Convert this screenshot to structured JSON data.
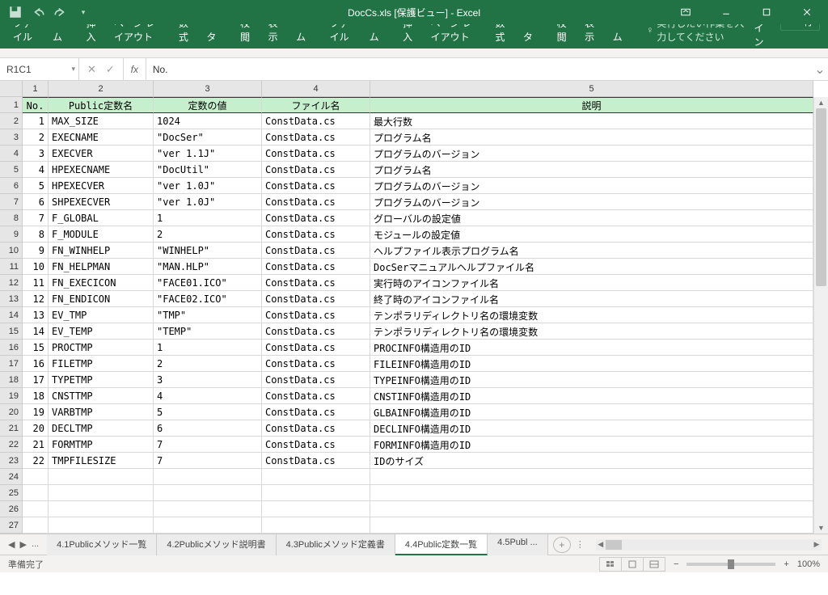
{
  "title": "DocCs.xls  [保護ビュー] - Excel",
  "ribbon": {
    "tabs": [
      "ファイル",
      "ホーム",
      "挿入",
      "ページ レイアウト",
      "数式",
      "データ",
      "校閲",
      "表示",
      "チーム"
    ],
    "tellme": "実行したい作業を入力してください",
    "signin": "サインイン",
    "share": "共有"
  },
  "namebox": "R1C1",
  "formula": "No.",
  "col_headers": [
    "1",
    "2",
    "3",
    "4",
    "5"
  ],
  "row_headers": [
    "1",
    "2",
    "3",
    "4",
    "5",
    "6",
    "7",
    "8",
    "9",
    "10",
    "11",
    "12",
    "13",
    "14",
    "15",
    "16",
    "17",
    "18",
    "19",
    "20",
    "21",
    "22",
    "23",
    "24",
    "25",
    "26",
    "27"
  ],
  "table": {
    "headers": [
      "No.",
      "Public定数名",
      "定数の値",
      "ファイル名",
      "説明"
    ],
    "rows": [
      [
        "1",
        "MAX_SIZE",
        "1024",
        "ConstData.cs",
        "最大行数"
      ],
      [
        "2",
        "EXECNAME",
        "\"DocSer\"",
        "ConstData.cs",
        "プログラム名"
      ],
      [
        "3",
        "EXECVER",
        "\"ver 1.1J\"",
        "ConstData.cs",
        "プログラムのバージョン"
      ],
      [
        "4",
        "HPEXECNAME",
        "\"DocUtil\"",
        "ConstData.cs",
        "プログラム名"
      ],
      [
        "5",
        "HPEXECVER",
        "\"ver 1.0J\"",
        "ConstData.cs",
        "プログラムのバージョン"
      ],
      [
        "6",
        "SHPEXECVER",
        "\"ver 1.0J\"",
        "ConstData.cs",
        "プログラムのバージョン"
      ],
      [
        "7",
        "F_GLOBAL",
        "1",
        "ConstData.cs",
        "グローバルの設定値"
      ],
      [
        "8",
        "F_MODULE",
        "2",
        "ConstData.cs",
        "モジュールの設定値"
      ],
      [
        "9",
        "FN_WINHELP",
        "\"WINHELP\"",
        "ConstData.cs",
        "ヘルプファイル表示プログラム名"
      ],
      [
        "10",
        "FN_HELPMAN",
        "\"MAN.HLP\"",
        "ConstData.cs",
        "DocSerマニュアルヘルプファイル名"
      ],
      [
        "11",
        "FN_EXECICON",
        "\"FACE01.ICO\"",
        "ConstData.cs",
        "実行時のアイコンファイル名"
      ],
      [
        "12",
        "FN_ENDICON",
        "\"FACE02.ICO\"",
        "ConstData.cs",
        "終了時のアイコンファイル名"
      ],
      [
        "13",
        "EV_TMP",
        "\"TMP\"",
        "ConstData.cs",
        "テンポラリディレクトリ名の環境変数"
      ],
      [
        "14",
        "EV_TEMP",
        "\"TEMP\"",
        "ConstData.cs",
        "テンポラリディレクトリ名の環境変数"
      ],
      [
        "15",
        "PROCTMP",
        "1",
        "ConstData.cs",
        "PROCINFO構造用のID"
      ],
      [
        "16",
        "FILETMP",
        "2",
        "ConstData.cs",
        "FILEINFO構造用のID"
      ],
      [
        "17",
        "TYPETMP",
        "3",
        "ConstData.cs",
        "TYPEINFO構造用のID"
      ],
      [
        "18",
        "CNSTTMP",
        "4",
        "ConstData.cs",
        "CNSTINFO構造用のID"
      ],
      [
        "19",
        "VARBTMP",
        "5",
        "ConstData.cs",
        "GLBAINFO構造用のID"
      ],
      [
        "20",
        "DECLTMP",
        "6",
        "ConstData.cs",
        "DECLINFO構造用のID"
      ],
      [
        "21",
        "FORMTMP",
        "7",
        "ConstData.cs",
        "FORMINFO構造用のID"
      ],
      [
        "22",
        "TMPFILESIZE",
        "7",
        "ConstData.cs",
        "IDのサイズ"
      ]
    ]
  },
  "sheet_tabs": {
    "ellipsis": "...",
    "tabs": [
      {
        "label": "4.1Publicメソッド一覧",
        "active": false
      },
      {
        "label": "4.2Publicメソッド説明書",
        "active": false
      },
      {
        "label": "4.3Publicメソッド定義書",
        "active": false
      },
      {
        "label": "4.4Public定数一覧",
        "active": true
      },
      {
        "label": "4.5Publ ...",
        "active": false
      }
    ]
  },
  "status": {
    "left": "準備完了",
    "zoom": "100%"
  }
}
